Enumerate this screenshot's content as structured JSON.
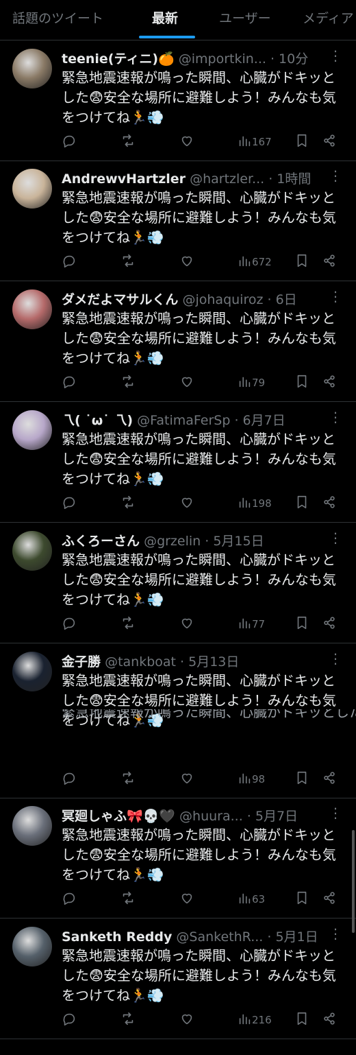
{
  "tabs": [
    {
      "label": "話題のツイート"
    },
    {
      "label": "最新"
    },
    {
      "label": "ユーザー"
    },
    {
      "label": "メディア"
    }
  ],
  "tweet_text": "緊急地震速報が鳴った瞬間、心臓がドキッとした😨安全な場所に避難しよう！みんなも気をつけてね🏃💨",
  "tweets": [
    {
      "name": "teenie(ティニ)🍊",
      "handle": "@importkin...",
      "time": "· 10分",
      "views": "167",
      "avatar_color": "#8a7a66"
    },
    {
      "name": "AndrewvHartzler",
      "handle": "@hartzler...",
      "time": "· 1時間",
      "views": "672",
      "avatar_color": "#c9b49a"
    },
    {
      "name": "ダメだよマサルくん",
      "handle": "@johaquiroz",
      "time": "· 6日",
      "views": "79",
      "avatar_color": "#b56a6a"
    },
    {
      "name": "乁( ˙ω˙ 乁)",
      "handle": "@FatimaFerSp",
      "time": "· 6月7日",
      "views": "198",
      "avatar_color": "#b7a7c9"
    },
    {
      "name": "ふくろーさん",
      "handle": "@grzelin",
      "time": "· 5月15日",
      "views": "77",
      "avatar_color": "#3d4a2e"
    },
    {
      "name": "金子勝",
      "handle": "@tankboat",
      "time": "· 5月13日",
      "views": "98",
      "avatar_color": "#1a2230"
    },
    {
      "name": "冥廻しゃふ🎀💀🖤",
      "handle": "@huura...",
      "time": "· 5月7日",
      "views": "63",
      "avatar_color": "#6a6f7a"
    },
    {
      "name": "Sanketh Reddy",
      "handle": "@SankethR...",
      "time": "· 5月1日",
      "views": "216",
      "avatar_color": "#55606a"
    }
  ],
  "colors": {
    "accent": "#1d9bf0",
    "muted": "#71767b",
    "text": "#e7e9ea",
    "divider": "#2f3336"
  }
}
